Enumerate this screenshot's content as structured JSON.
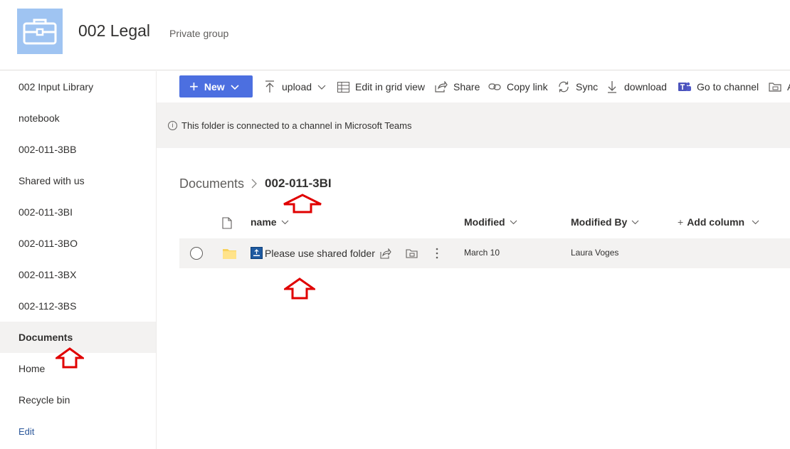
{
  "site": {
    "title": "002 Legal",
    "privacy": "Private group",
    "logo_icon": "briefcase-icon"
  },
  "nav": {
    "items": [
      {
        "label": "002 Input Library"
      },
      {
        "label": "notebook"
      },
      {
        "label": "002-011-3BB"
      },
      {
        "label": "Shared with us"
      },
      {
        "label": "002-011-3BI"
      },
      {
        "label": "002-011-3BO"
      },
      {
        "label": "002-011-3BX"
      },
      {
        "label": "002-112-3BS"
      },
      {
        "label": "Documents",
        "active": true
      },
      {
        "label": "Home"
      },
      {
        "label": "Recycle bin"
      }
    ],
    "edit_label": "Edit"
  },
  "commands": {
    "new_label": "New",
    "upload_label": "upload",
    "grid_label": "Edit in grid view",
    "share_label": "Share",
    "copylink_label": "Copy link",
    "sync_label": "Sync",
    "download_label": "download",
    "channel_label": "Go to channel",
    "more_label": "A"
  },
  "banner": {
    "text": "This folder is connected to a channel in Microsoft Teams"
  },
  "breadcrumb": {
    "root": "Documents",
    "current": "002-011-3BI"
  },
  "columns": {
    "name": "name",
    "modified": "Modified",
    "modified_by": "Modified By",
    "add_column": "Add column"
  },
  "rows": [
    {
      "name": "Please use shared folder",
      "modified": "March 10",
      "modified_by": "Laura Voges"
    }
  ],
  "colors": {
    "accent": "#4c6fe0",
    "logo_bg": "#9fc4f2",
    "annotation_red": "#e00000",
    "folder_yellow": "#f8d25c"
  }
}
